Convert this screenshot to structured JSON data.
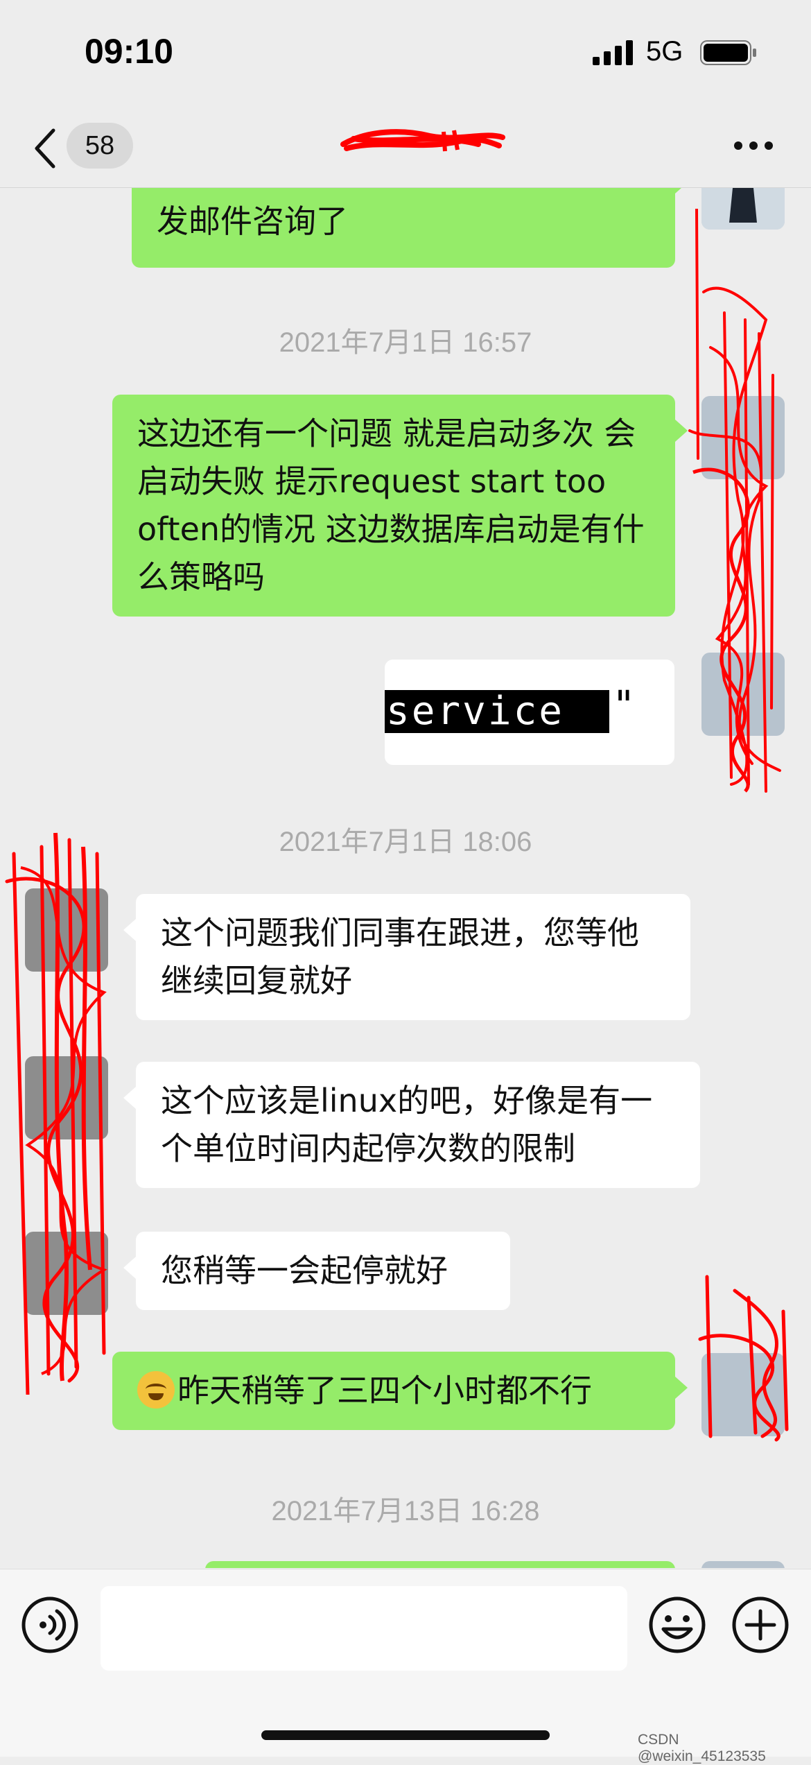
{
  "status_bar": {
    "time": "09:10",
    "network": "5G"
  },
  "nav": {
    "unread_count": "58"
  },
  "messages": [
    {
      "text": "发邮件咨询了",
      "partial_top": "...",
      "side": "out"
    },
    {
      "type": "timestamp",
      "text": "2021年7月1日 16:57"
    },
    {
      "text": "这边还有一个问题 就是启动多次 会启动失败 提示request start too often的情况 这边数据库启动是有什么策略吗",
      "side": "out"
    },
    {
      "type": "image",
      "code_text": "service",
      "quote": "\""
    },
    {
      "type": "timestamp",
      "text": "2021年7月1日 18:06"
    },
    {
      "text": "这个问题我们同事在跟进，您等他继续回复就好",
      "side": "in"
    },
    {
      "text": "这个应该是linux的吧，好像是有一个单位时间内起停次数的限制",
      "side": "in"
    },
    {
      "text": "您稍等一会起停就好",
      "side": "in"
    },
    {
      "text": "昨天稍等了三四个小时都不行",
      "side": "out"
    },
    {
      "type": "timestamp",
      "text": "2021年7月13日 16:28"
    }
  ],
  "input": {
    "value": "",
    "placeholder": ""
  },
  "watermark": "CSDN @weixin_45123535",
  "colors": {
    "background": "#ededed",
    "outgoing_bubble": "#95ec69",
    "incoming_bubble": "#ffffff",
    "timestamp": "#aaaaaa",
    "scribble": "#ff0000"
  }
}
